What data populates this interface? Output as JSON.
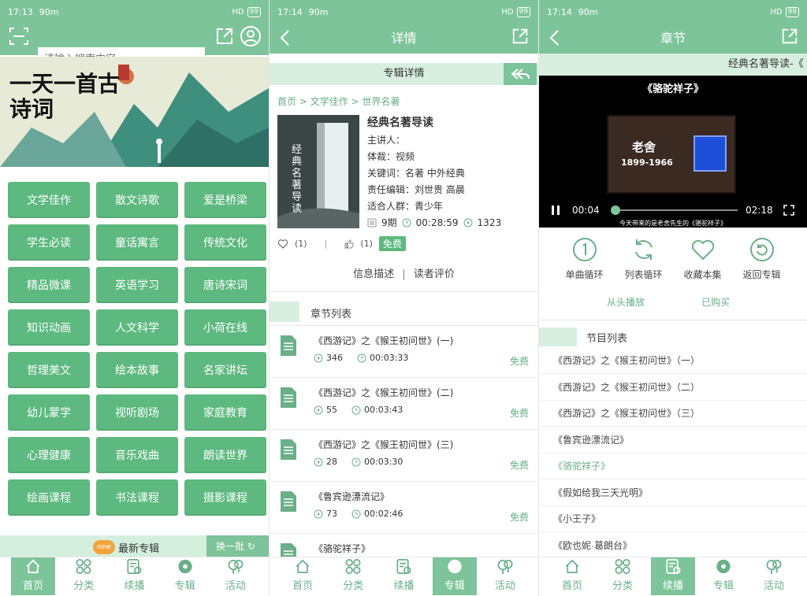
{
  "colors": {
    "primary": "#7ec49a",
    "button": "#5db97f",
    "light": "#d8efe0",
    "accent": "#6aaf88"
  },
  "status": {
    "time": "17:13",
    "time2": "17:14",
    "time3": "17:14",
    "speed": "90m",
    "signal": "HD",
    "battery": "99"
  },
  "home": {
    "search_placeholder": "请输入搜索内容",
    "banner_text": "一天一首古诗词",
    "categories": [
      "文学佳作",
      "散文诗歌",
      "爱是桥梁",
      "学生必读",
      "童话寓言",
      "传统文化",
      "精品微课",
      "英语学习",
      "唐诗宋词",
      "知识动画",
      "人文科学",
      "小荷在线",
      "哲理美文",
      "绘本故事",
      "名家讲坛",
      "幼儿蒙学",
      "视听剧场",
      "家庭教育",
      "心理健康",
      "音乐戏曲",
      "朗读世界",
      "绘画课程",
      "书法课程",
      "摄影课程"
    ],
    "new_badge": "new",
    "new_title": "最新专辑",
    "refresh": "换一批"
  },
  "tabs": [
    "首页",
    "分类",
    "续播",
    "专辑",
    "活动"
  ],
  "detail": {
    "title": "详情",
    "section": "专辑详情",
    "breadcrumb": "首页 > 文学佳作 > 世界名著",
    "cover_text": "经典名著导读",
    "album_title": "经典名著导读",
    "speaker": "主讲人：",
    "genre": "体裁：视频",
    "keywords": "关键词：名著 中外经典",
    "editor": "责任编辑：刘世贵 高晨",
    "audience": "适合人群：青少年",
    "episodes": "9期",
    "duration": "00:28:59",
    "plays": "1323",
    "fav_count": "(1)",
    "like_count": "(1)",
    "free": "免费",
    "tab_info": "信息描述",
    "tab_review": "读者评价",
    "chapter_header": "章节列表",
    "chapters": [
      {
        "title": "《西游记》之《猴王初问世》(一)",
        "plays": "346",
        "duration": "00:03:33",
        "free": "免费"
      },
      {
        "title": "《西游记》之《猴王初问世》(二)",
        "plays": "55",
        "duration": "00:03:43",
        "free": "免费"
      },
      {
        "title": "《西游记》之《猴王初问世》(三)",
        "plays": "28",
        "duration": "00:03:30",
        "free": "免费"
      },
      {
        "title": "《鲁宾逊漂流记》",
        "plays": "73",
        "duration": "00:02:46",
        "free": "免费"
      },
      {
        "title": "《骆驼祥子》",
        "plays": "",
        "duration": "",
        "free": ""
      }
    ]
  },
  "chapter": {
    "title": "章节",
    "marquee": "经典名著导读-《",
    "video_title": "《骆驼祥子》",
    "video_author": "老舍",
    "video_years": "1899-1966",
    "subtitle": "今天带来的是老舍先生的《骆驼祥子》",
    "time_now": "00:04",
    "time_total": "02:18",
    "progress": 0.03,
    "controls": [
      "单曲循环",
      "列表循环",
      "收藏本集",
      "返回专辑"
    ],
    "play_from_start": "从头播放",
    "purchased": "已购买",
    "program_header": "节目列表",
    "programs": [
      "《西游记》之《猴王初问世》（一）",
      "《西游记》之《猴王初问世》（二）",
      "《西游记》之《猴王初问世》（三）",
      "《鲁宾逊漂流记》",
      "《骆驼祥子》",
      "《假如给我三天光明》",
      "《小王子》",
      "《欧也妮·葛朗台》"
    ],
    "active_program": 4
  }
}
